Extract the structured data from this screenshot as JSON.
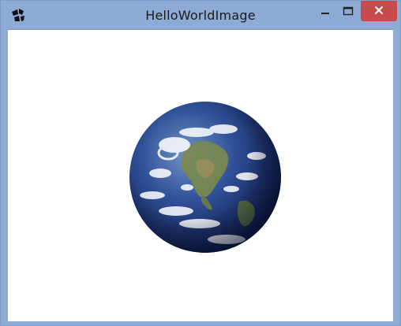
{
  "window": {
    "title": "HelloWorldImage",
    "app_icon": "java-window-icon",
    "controls": {
      "minimize_icon": "minimize-icon",
      "maximize_icon": "maximize-icon",
      "close_icon": "close-icon",
      "close_color": "#c94a4a"
    }
  },
  "content": {
    "image": "earth-globe-image"
  },
  "colors": {
    "frame": "#8eabd6",
    "client_bg": "#ffffff"
  }
}
